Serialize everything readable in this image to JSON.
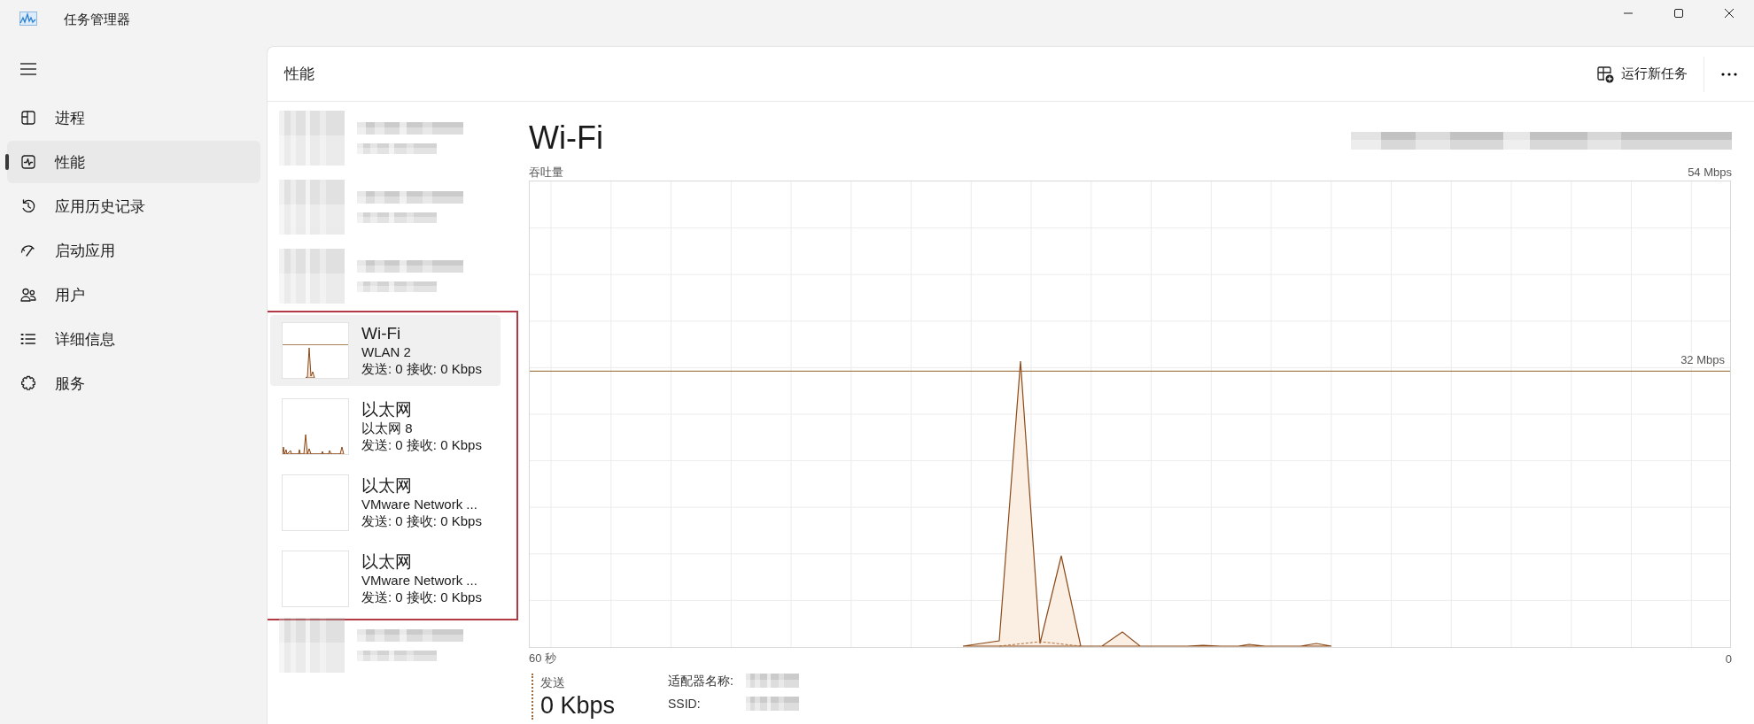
{
  "window": {
    "title": "任务管理器"
  },
  "sidebar": {
    "items": [
      {
        "kind": "processes",
        "label": "进程",
        "selected": false
      },
      {
        "kind": "performance",
        "label": "性能",
        "selected": true
      },
      {
        "kind": "history",
        "label": "应用历史记录",
        "selected": false
      },
      {
        "kind": "startup",
        "label": "启动应用",
        "selected": false
      },
      {
        "kind": "users",
        "label": "用户",
        "selected": false
      },
      {
        "kind": "details",
        "label": "详细信息",
        "selected": false
      },
      {
        "kind": "services",
        "label": "服务",
        "selected": false
      }
    ]
  },
  "header": {
    "title": "性能",
    "action": "运行新任务"
  },
  "devices_above": [
    {
      "kind": "redacted"
    },
    {
      "kind": "redacted"
    },
    {
      "kind": "redacted"
    }
  ],
  "highlighted_devices": [
    {
      "kind": "network",
      "graph": {
        "kind": "spike"
      },
      "name": "Wi-Fi",
      "detail": "WLAN 2",
      "rate": "发送: 0 接收: 0 Kbps",
      "selected": true
    },
    {
      "kind": "network",
      "graph": {
        "kind": "bursts"
      },
      "name": "以太网",
      "detail": "以太网 8",
      "rate": "发送: 0 接收: 0 Kbps",
      "selected": false
    },
    {
      "kind": "network",
      "graph": {
        "kind": "idle"
      },
      "name": "以太网",
      "detail": "VMware Network ...",
      "rate": "发送: 0 接收: 0 Kbps",
      "selected": false
    },
    {
      "kind": "network",
      "graph": {
        "kind": "idle"
      },
      "name": "以太网",
      "detail": "VMware Network ...",
      "rate": "发送: 0 接收: 0 Kbps",
      "selected": false
    }
  ],
  "devices_below": [
    {
      "kind": "redacted"
    }
  ],
  "detail": {
    "title": "Wi-Fi",
    "chart_label": "吞吐量",
    "scale_max": "54 Mbps",
    "reference_label": "32 Mbps",
    "time_span": "60 秒",
    "scale_min": "0",
    "send": {
      "label": "发送",
      "value": "0 Kbps"
    },
    "properties": [
      {
        "label": "适配器名称:"
      },
      {
        "label": "SSID:"
      }
    ]
  }
}
